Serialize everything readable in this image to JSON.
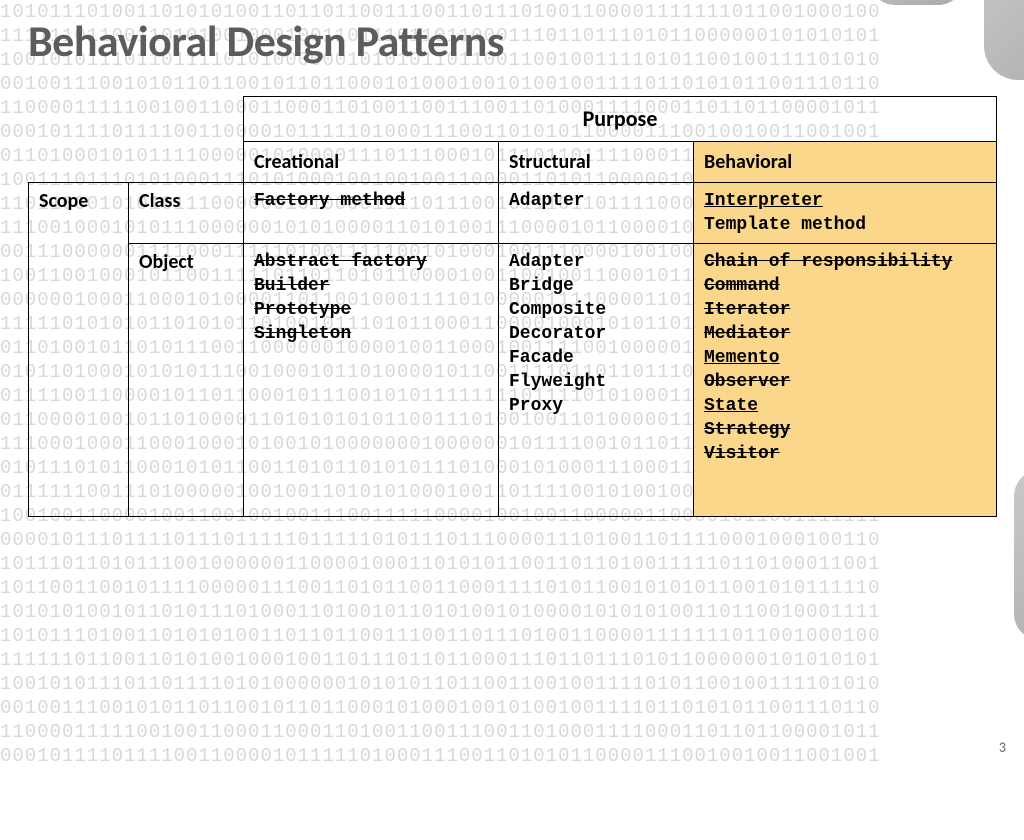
{
  "title": "Behavioral Design Patterns",
  "page_number": "3",
  "table": {
    "purpose_header": "Purpose",
    "col_creational": "Creational",
    "col_structural": "Structural",
    "col_behavioral": "Behavioral",
    "scope_label": "Scope",
    "row_class": "Class",
    "row_object": "Object",
    "class_creational": "Factory method",
    "class_structural": "Adapter",
    "class_behavioral_1": "Interpreter",
    "class_behavioral_2": "Template method",
    "obj_creational_1": "Abstract factory",
    "obj_creational_2": "Builder",
    "obj_creational_3": "Prototype",
    "obj_creational_4": "Singleton",
    "obj_structural_1": "Adapter",
    "obj_structural_2": "Bridge",
    "obj_structural_3": "Composite",
    "obj_structural_4": "Decorator",
    "obj_structural_5": "Facade",
    "obj_structural_6": "Flyweight",
    "obj_structural_7": "Proxy",
    "obj_behavioral_1": "Chain of responsibility",
    "obj_behavioral_2": "Command",
    "obj_behavioral_3": "Iterator",
    "obj_behavioral_4": "Mediator",
    "obj_behavioral_5": "Memento",
    "obj_behavioral_6": "Observer",
    "obj_behavioral_7": "State",
    "obj_behavioral_8": "Strategy",
    "obj_behavioral_9": "Visitor"
  },
  "binary_lines": [
    "10101110100110101010011011011001110011011101001100001111111011001000100",
    "11111101100110101001000100110111011011000111011011101011000000101010101",
    "10010101110110111101010000001010101101100110010011110101100100111101010",
    "00100111001010110110010110110001010001001010010011110110101011001110110",
    "11000011111001001100011000110100110011100110100011110001101101100001011",
    "00010111101111001100001011111010001110011010101100001110010010011001001",
    "01101000101011110000010100001110111000101110110111100011100011110010011",
    "10011101110101000111010100010010010011000011010110000010001100100011101",
    "11011000101010111000000101000011110111001011101101111000000010001100011",
    "11100100010101110000001010100001101010011100001011000010100000100110000",
    "00111000000111100011111010011111001010001001110000100100101001011100110",
    "10011001000101100111110110110101100001001100100110001011001001001101011",
    "00000010001100010100001101100100011110100000111100001101001100010011001",
    "11111010101011010101101001011101011000110000100010101101100010101001100",
    "01101001011010111001100000010000100110001001111001000001011100001000101",
    "01011010001010101110010001011010000101100111101101101110110110100010010",
    "01111001100001011011000101110010101111111101111010100011100011001111001",
    "01100001001011010000110101010101100111010010011010000011011110001110100",
    "11100010001100010001010010100000001000000101111001011011100011001011110",
    "01011101011000101011001101011010101110100010100011100011110001100000000",
    "01111110011101000001001001101010100010011011110010100100001001000101010",
    "10010011000010011001001001110011111000010010011000001100001011001111111",
    "00001011101111011101111101111101011101110000111010011011110001000100110",
    "10111011010111001000000110000100011010101100110110100111110110100011001",
    "10110011001011110000011100110101100110001111010110010101011001010111110",
    "10101010010110101110100011010010110101001010000101010100110110010001111",
    "10101110100110101010011011011001110011011101001100001111111011001000100",
    "11111101100110101001000100110111011011000111011011101011000000101010101",
    "10010101110110111101010000001010101101100110010011110101100100111101010",
    "00100111001010110110010110110001010001001010010011110110101011001110110",
    "11000011111001001100011000110100110011100110100011110001101101100001011",
    "00010111101111001100001011111010001110011010101100001110010010011001001"
  ]
}
